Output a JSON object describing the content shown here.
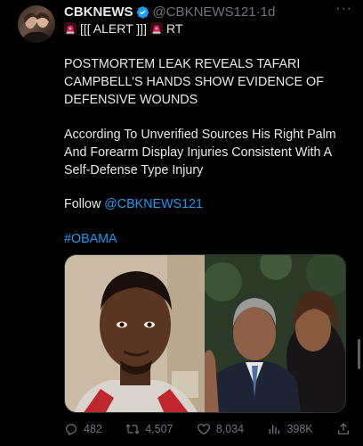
{
  "tweet": {
    "author_name": "CBKNEWS",
    "author_handle": "@CBKNEWS121",
    "time": "1d",
    "time_sep": "·",
    "more_label": "···",
    "alert_text": "[[[ ALERT ]]]",
    "rt_text": "RT",
    "headline": "POSTMORTEM LEAK REVEALS TAFARI CAMPBELL'S HANDS SHOW EVIDENCE OF DEFENSIVE WOUNDS",
    "paragraph": "According To Unverified Sources His Right Palm And Forearm Display Injuries Consistent With A Self-Defense Type Injury",
    "follow_prefix": "Follow ",
    "follow_handle": "@CBKNEWS121",
    "hashtag": "#OBAMA"
  },
  "actions": {
    "replies": "482",
    "reposts": "4,507",
    "likes": "8,034",
    "views": "398K"
  },
  "colors": {
    "background": "#000000",
    "text": "#e7e9ea",
    "muted": "#71767b",
    "link": "#1d9bf0",
    "verified": "#1d9bf0",
    "siren": "#e0245e"
  },
  "icons": {
    "verified": "verified-badge-icon",
    "siren": "police-siren-icon",
    "reply": "reply-icon",
    "repost": "repost-icon",
    "like": "like-icon",
    "views": "views-icon",
    "share": "share-icon"
  }
}
